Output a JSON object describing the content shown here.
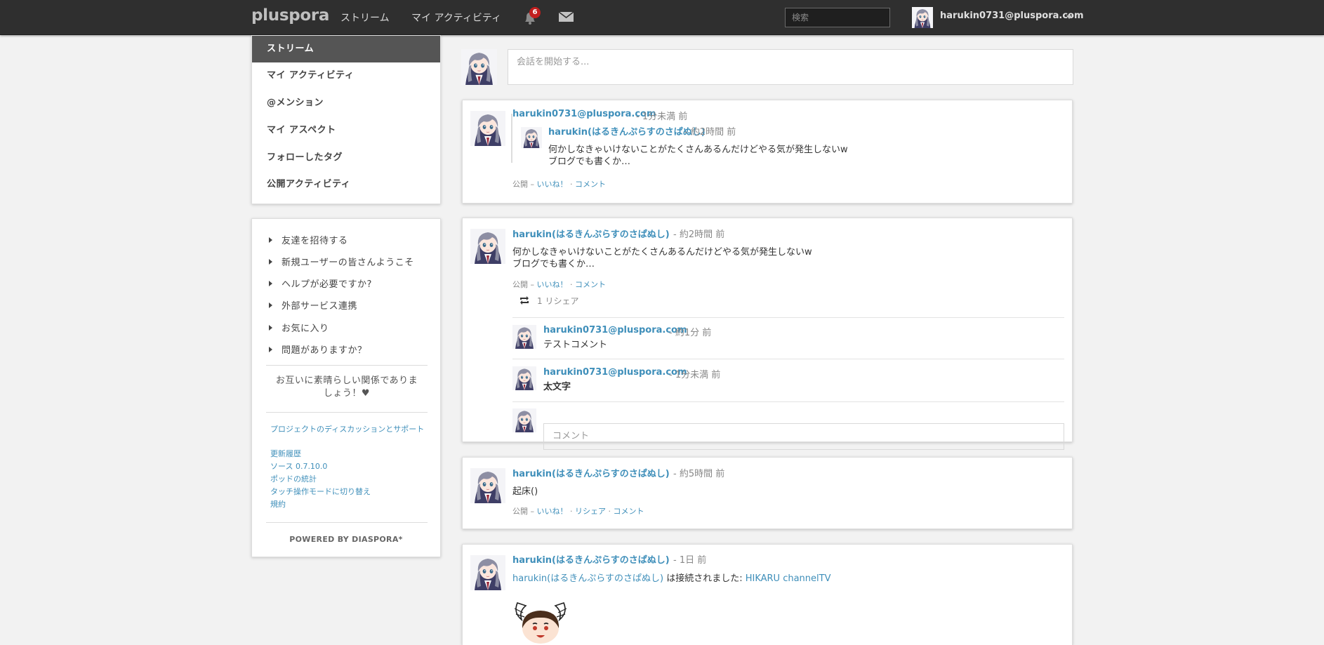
{
  "header": {
    "brand": "pluspora",
    "nav": [
      {
        "label": "ストリーム"
      },
      {
        "label": "マイ アクティビティ"
      }
    ],
    "notification_count": "6",
    "search_placeholder": "検索",
    "user_name": "harukin0731@pluspora.com",
    "icons": {
      "notifications": "bell-icon",
      "messages": "envelope-icon",
      "menu": "caret-down-icon"
    }
  },
  "left_nav": {
    "items": [
      {
        "label": "ストリーム",
        "active": true
      },
      {
        "label": "マイ アクティビティ"
      },
      {
        "label": "@メンション"
      },
      {
        "label": "マイ アスペクト"
      },
      {
        "label": "フォローしたタグ"
      },
      {
        "label": "公開アクティビティ"
      }
    ]
  },
  "info": {
    "items": [
      {
        "label": "友達を招待する"
      },
      {
        "label": "新規ユーザーの皆さんようこそ"
      },
      {
        "label": "ヘルプが必要ですか?"
      },
      {
        "label": "外部サービス連携"
      },
      {
        "label": "お気に入り"
      },
      {
        "label": "問題がありますか？"
      }
    ],
    "love_text": "お互いに素晴らしい関係でありましょう！♥",
    "links": [
      {
        "label": "プロジェクトのディスカッションとサポート"
      },
      {
        "label": "更新履歴"
      },
      {
        "label": "ソース 0.7.10.0"
      },
      {
        "label": "ポッドの統計"
      },
      {
        "label": "タッチ操作モードに切り替え"
      },
      {
        "label": "規約"
      }
    ],
    "powered": "POWERED BY DIASPORA*"
  },
  "publisher": {
    "placeholder": "会話を開始する..."
  },
  "posts": [
    {
      "author": "harukin0731@pluspora.com",
      "time": "- 1分未満 前",
      "reshare": {
        "author": "harukin(はるきんぷらすのさぱぬし)",
        "time": "- 約2時間 前",
        "line1": "何かしなきゃいけないことがたくさんあるんだけどやる気が発生しないw",
        "line2": "ブログでも書くか…"
      },
      "meta_prefix": "公開 – ",
      "like": "いいね！",
      "dot": " · ",
      "comment": "コメント"
    },
    {
      "author": "harukin(はるきんぷらすのさぱぬし)",
      "time": "- 約2時間 前",
      "line1": "何かしなきゃいけないことがたくさんあるんだけどやる気が発生しないw",
      "line2": "ブログでも書くか…",
      "meta_prefix": "公開 – ",
      "like": "いいね！",
      "dot": " · ",
      "comment": "コメント",
      "reshares": "1 リシェア",
      "comments": [
        {
          "author": "harukin0731@pluspora.com",
          "time": "- 約1分 前",
          "text": "テストコメント"
        },
        {
          "author": "harukin0731@pluspora.com",
          "time": "- 1分未満 前",
          "text": "太文字"
        }
      ],
      "comment_placeholder": "コメント"
    },
    {
      "author": "harukin(はるきんぷらすのさぱぬし)",
      "time": "- 約5時間 前",
      "text": "起床()",
      "meta_prefix": "公開 – ",
      "like": "いいね！",
      "dot": " · ",
      "reshare": "リシェア",
      "comment": "コメント"
    },
    {
      "author": "harukin(はるきんぷらすのさぱぬし)",
      "time": "- 1日 前",
      "conn_user": "harukin(はるきんぷらすのさぱぬし)",
      "conn_text": " は接続されました: ",
      "conn_service": "HIKARU channelTV"
    }
  ],
  "colors": {
    "accent": "#3f8fba",
    "header_bg": "#2f2f2f",
    "badge": "#c21e1e",
    "active_nav": "#555555"
  }
}
